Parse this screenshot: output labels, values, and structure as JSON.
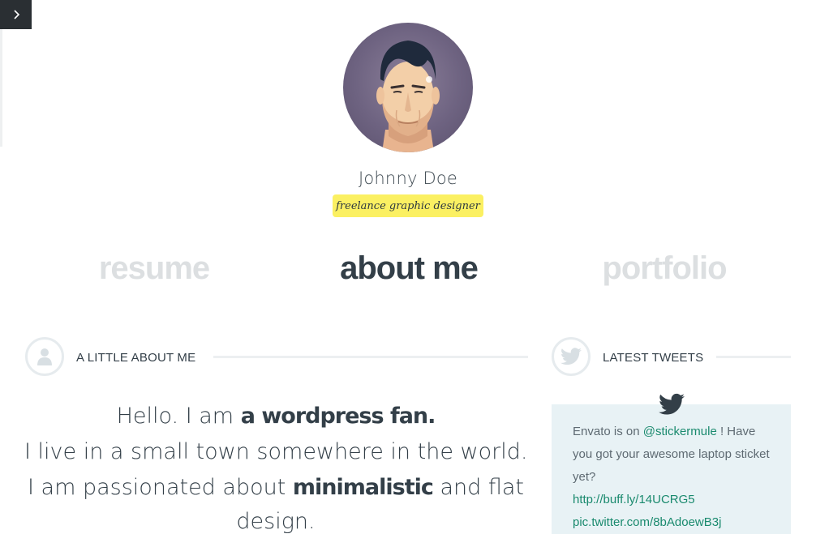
{
  "sidebar_toggle": {
    "icon": "chevron-right-icon"
  },
  "profile": {
    "name": "Johnny Doe",
    "tagline": "freelance graphic designer"
  },
  "nav": {
    "items": [
      {
        "label": "resume",
        "active": false
      },
      {
        "label": "about me",
        "active": true
      },
      {
        "label": "portfolio",
        "active": false
      }
    ]
  },
  "about": {
    "heading": "A LITTLE ABOUT ME",
    "icon": "user-icon",
    "line1_pre": "Hello. I am ",
    "line1_bold": "a wordpress fan.",
    "line2": "I live in a small town somewhere in the world.",
    "line3_pre": "I am passionated about ",
    "line3_bold": "minimalistic",
    "line3_post": " and flat",
    "line4": "design."
  },
  "tweets": {
    "heading": "LATEST TWEETS",
    "icon": "twitter-icon",
    "tweet_pre": "Envato is on ",
    "mention": "@stickermule",
    "tweet_mid": " ! Have you got your awesome laptop sticket yet?",
    "link1": "http://buff.ly/14UCRG5",
    "link2": "pic.twitter.com/8bAdoewB3j"
  },
  "colors": {
    "accent_text": "#333f48",
    "inactive_nav": "#dcdfe1",
    "tagline_bg": "#fbf062",
    "tweet_bg": "#e8f2f5",
    "link": "#1a8a6e"
  }
}
